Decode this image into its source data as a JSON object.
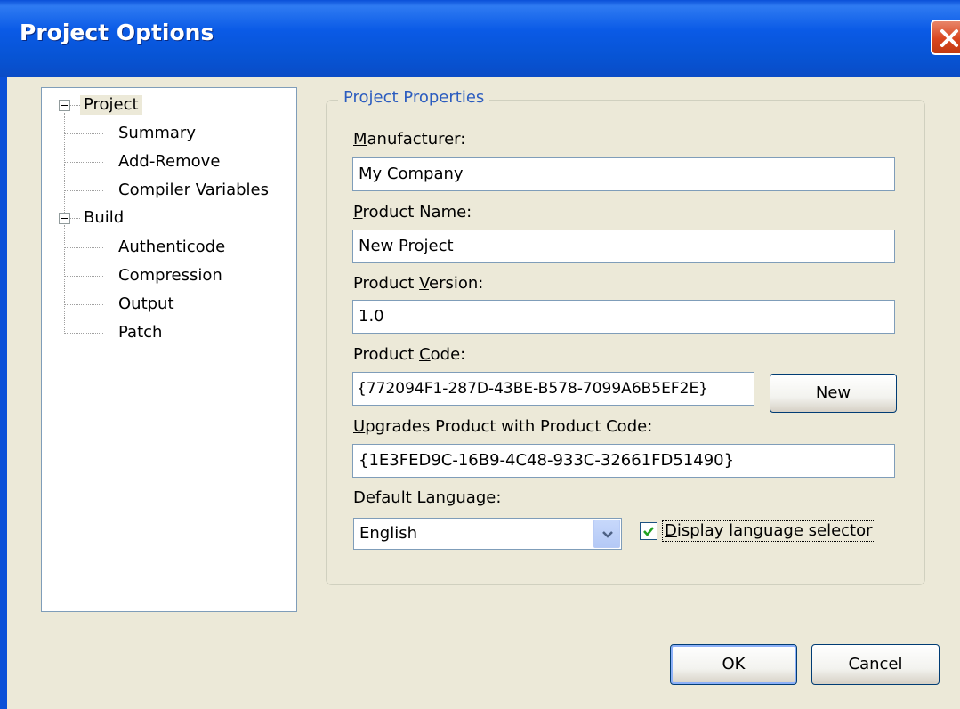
{
  "window": {
    "title": "Project Options"
  },
  "tree": {
    "items": [
      {
        "label": "Project",
        "children": [
          "Summary",
          "Add-Remove",
          "Compiler Variables"
        ]
      },
      {
        "label": "Build",
        "children": [
          "Authenticode",
          "Compression",
          "Output",
          "Patch"
        ]
      }
    ],
    "selected": "Project"
  },
  "group": {
    "label": "Project Properties"
  },
  "fields": {
    "manufacturer": {
      "label_pre": "",
      "label_u": "M",
      "label_post": "anufacturer:",
      "value": "My Company"
    },
    "product_name": {
      "label_pre": "",
      "label_u": "P",
      "label_post": "roduct Name:",
      "value": "New Project"
    },
    "product_version": {
      "label_pre": "Product ",
      "label_u": "V",
      "label_post": "ersion:",
      "value": "1.0"
    },
    "product_code": {
      "label_pre": "Product ",
      "label_u": "C",
      "label_post": "ode:",
      "value": "{772094F1-287D-43BE-B578-7099A6B5EF2E}"
    },
    "upgrade_code": {
      "label_pre": "",
      "label_u": "U",
      "label_post": "pgrades Product with Product Code:",
      "value": "{1E3FED9C-16B9-4C48-933C-32661FD51490}"
    },
    "default_language": {
      "label_pre": "Default ",
      "label_u": "L",
      "label_post": "anguage:",
      "value": "English"
    }
  },
  "new_button": {
    "label_u": "N",
    "label_post": "ew"
  },
  "checkbox": {
    "checked": true,
    "label_pre": "",
    "label_u": "D",
    "label_post": "isplay language selector"
  },
  "buttons": {
    "ok": "OK",
    "cancel": "Cancel"
  },
  "colors": {
    "titlebar": "#0a5ae6",
    "background": "#ece9d8",
    "group_label": "#2b5cbf"
  }
}
